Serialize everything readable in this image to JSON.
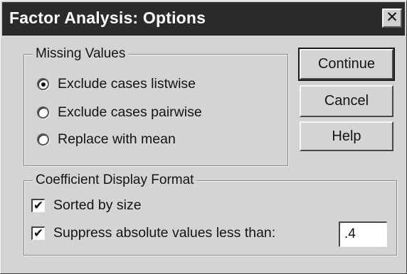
{
  "window": {
    "title": "Factor Analysis: Options",
    "close_glyph": "✕"
  },
  "missing_values": {
    "legend": "Missing Values",
    "options": [
      {
        "label": "Exclude cases listwise",
        "selected": true
      },
      {
        "label": "Exclude cases pairwise",
        "selected": false
      },
      {
        "label": "Replace with mean",
        "selected": false
      }
    ]
  },
  "coefficient_display": {
    "legend": "Coefficient Display Format",
    "sorted_label": "Sorted by size",
    "sorted_checked": true,
    "suppress_label": "Suppress absolute values less than:",
    "suppress_checked": true,
    "suppress_value": ".4",
    "check_glyph": "✔"
  },
  "buttons": {
    "continue": "Continue",
    "cancel": "Cancel",
    "help": "Help"
  },
  "colors": {
    "dialog_bg": "#d4d4d4",
    "titlebar_bg": "#2b2b2b",
    "title_text": "#ffffff"
  }
}
